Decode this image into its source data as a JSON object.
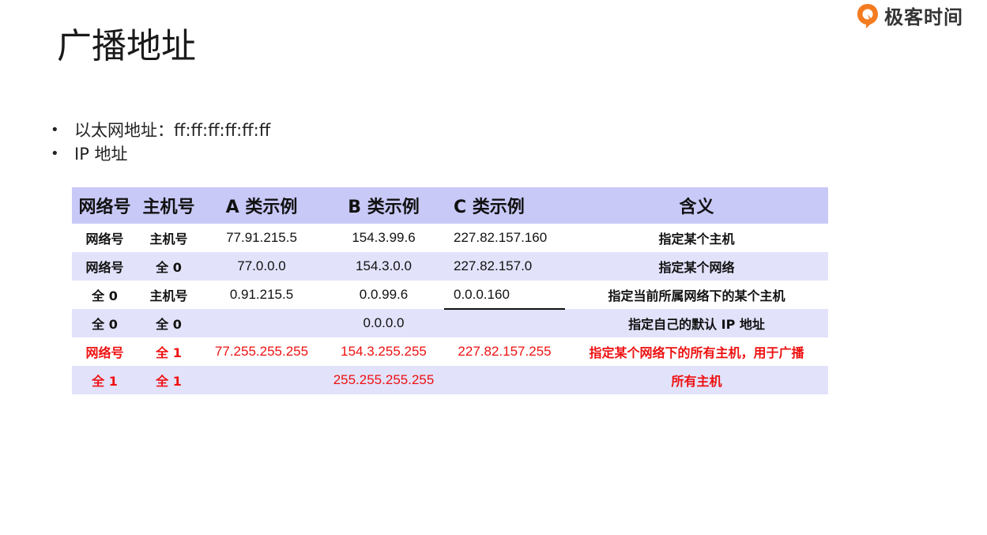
{
  "slide": {
    "title": "广播地址"
  },
  "logo": {
    "text": "极客时间"
  },
  "bullets": [
    "以太网地址：ff:ff:ff:ff:ff:ff",
    "IP 地址"
  ],
  "table": {
    "headers": [
      "网络号",
      "主机号",
      "A 类示例",
      "B 类示例",
      "C 类示例",
      "含义"
    ],
    "rows": [
      [
        "网络号",
        "主机号",
        "77.91.215.5",
        "154.3.99.6",
        "227.82.157.160",
        "指定某个主机"
      ],
      [
        "网络号",
        "全 0",
        "77.0.0.0",
        "154.3.0.0",
        "227.82.157.0",
        "指定某个网络"
      ],
      [
        "全 0",
        "主机号",
        "0.91.215.5",
        "0.0.99.6",
        "0.0.0.160",
        "指定当前所属网络下的某个主机"
      ],
      [
        "全 0",
        "全 0",
        "",
        "0.0.0.0",
        "",
        "指定自己的默认 IP 地址"
      ],
      [
        "网络号",
        "全 1",
        "77.255.255.255",
        "154.3.255.255",
        "227.82.157.255",
        "指定某个网络下的所有主机，用于广播"
      ],
      [
        "全 1",
        "全 1",
        "",
        "255.255.255.255",
        "",
        "所有主机"
      ]
    ],
    "highlight_color": "#ee1111",
    "header_bg": "#c9c9f8",
    "alt_row_bg": "#e2e2fb"
  },
  "brand_color": "#f47b20"
}
